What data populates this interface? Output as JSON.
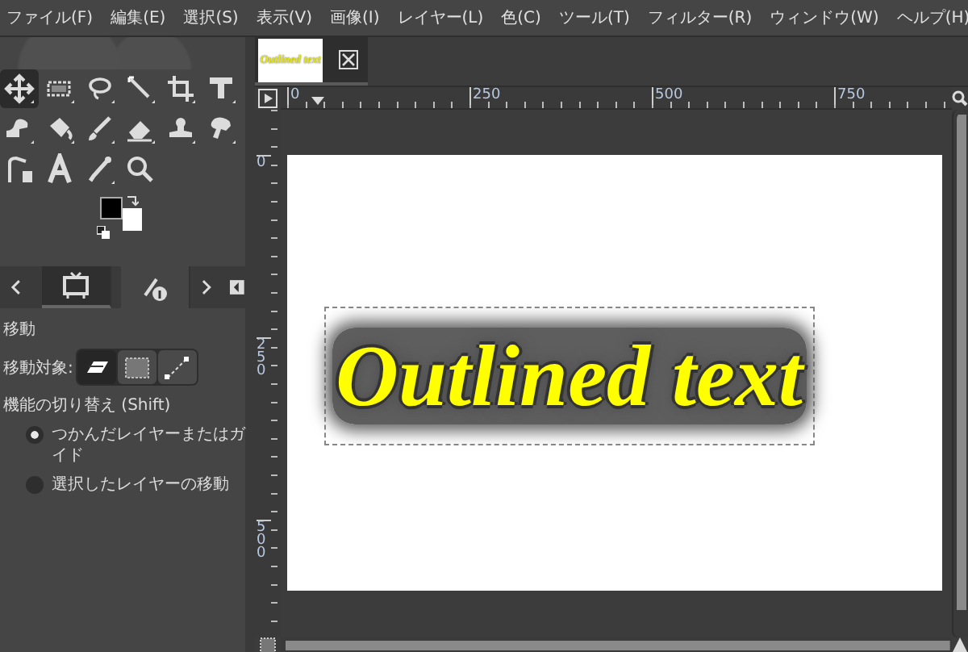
{
  "menu": [
    "ファイル(F)",
    "編集(E)",
    "選択(S)",
    "表示(V)",
    "画像(I)",
    "レイヤー(L)",
    "色(C)",
    "ツール(T)",
    "フィルター(R)",
    "ウィンドウ(W)",
    "ヘルプ(H)"
  ],
  "toolbox": {
    "tools": [
      {
        "kind": "move",
        "selected": true
      },
      {
        "kind": "rect-select",
        "selected": false
      },
      {
        "kind": "lasso",
        "selected": false
      },
      {
        "kind": "wand",
        "selected": false
      },
      {
        "kind": "crop",
        "selected": false
      },
      {
        "kind": "transform",
        "selected": false
      },
      {
        "kind": "warp",
        "selected": false
      },
      {
        "kind": "bucket",
        "selected": false
      },
      {
        "kind": "brush",
        "selected": false
      },
      {
        "kind": "eraser",
        "selected": false
      },
      {
        "kind": "stamp",
        "selected": false
      },
      {
        "kind": "smudge",
        "selected": false
      },
      {
        "kind": "path",
        "selected": false
      },
      {
        "kind": "text",
        "selected": false
      },
      {
        "kind": "picker",
        "selected": false
      },
      {
        "kind": "zoom",
        "selected": false
      }
    ]
  },
  "dock_tabs": [
    {
      "kind": "device-status",
      "selected": true
    },
    {
      "kind": "tool-presets",
      "selected": false
    }
  ],
  "tool_options": {
    "title": "移動",
    "move_target_label": "移動対象:",
    "move_targets": [
      {
        "kind": "layer",
        "selected": true
      },
      {
        "kind": "selection",
        "selected": false
      },
      {
        "kind": "path",
        "selected": false
      }
    ],
    "toggle_label": "機能の切り替え (Shift)",
    "toggle_options": [
      {
        "label": "つかんだレイヤーまたはガイド",
        "selected": true
      },
      {
        "label": "選択したレイヤーの移動",
        "selected": false
      }
    ]
  },
  "image_tabs": [
    {
      "thumbnail_text": "Outlined text",
      "selected": true
    }
  ],
  "rulers": {
    "horizontal": [
      "0",
      "250",
      "500",
      "750"
    ],
    "vertical": [
      "0",
      "250",
      "500"
    ]
  },
  "canvas": {
    "text": "Outlined text"
  }
}
